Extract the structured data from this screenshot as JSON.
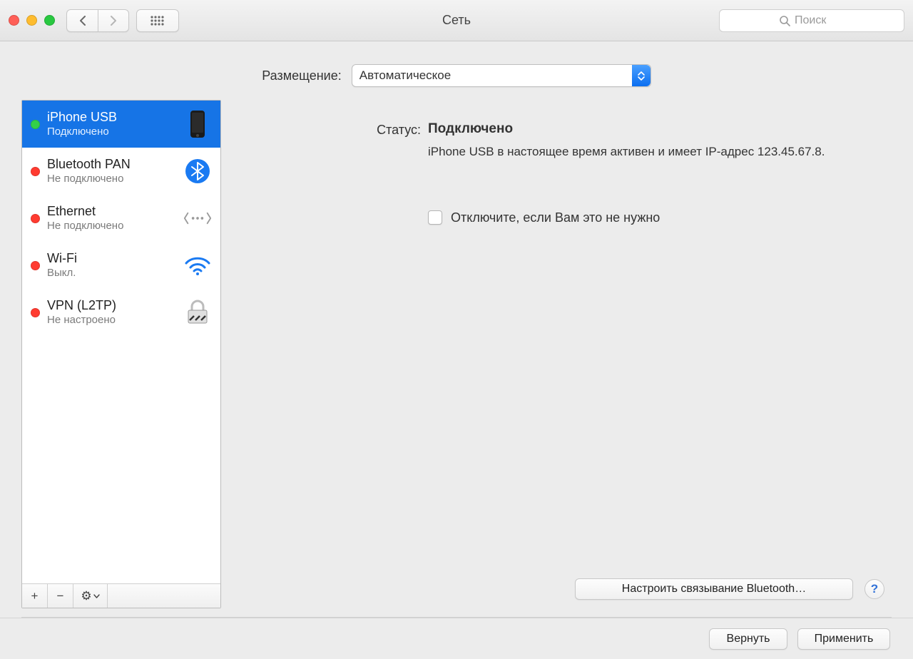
{
  "window": {
    "title": "Сеть"
  },
  "toolbar": {
    "search_placeholder": "Поиск"
  },
  "location": {
    "label": "Размещение:",
    "value": "Автоматическое"
  },
  "sidebar": {
    "items": [
      {
        "name": "iPhone USB",
        "sub": "Подключено",
        "status": "green",
        "icon": "iphone",
        "selected": true
      },
      {
        "name": "Bluetooth PAN",
        "sub": "Не подключено",
        "status": "red",
        "icon": "bluetooth",
        "selected": false
      },
      {
        "name": "Ethernet",
        "sub": "Не подключено",
        "status": "red",
        "icon": "ethernet",
        "selected": false
      },
      {
        "name": "Wi-Fi",
        "sub": "Выкл.",
        "status": "red",
        "icon": "wifi",
        "selected": false
      },
      {
        "name": "VPN (L2TP)",
        "sub": "Не настроено",
        "status": "red",
        "icon": "lock",
        "selected": false
      }
    ],
    "toolbar": {
      "add": "+",
      "remove": "−",
      "gear": "⚙︎"
    }
  },
  "details": {
    "status_label": "Статус:",
    "status_value": "Подключено",
    "description": "iPhone USB  в настоящее время активен и имеет IP-адрес 123.45.67.8.",
    "checkbox_label": "Отключите, если Вам это не нужно",
    "configure_bluetooth": "Настроить связывание Bluetooth…"
  },
  "footer": {
    "revert": "Вернуть",
    "apply": "Применить"
  }
}
